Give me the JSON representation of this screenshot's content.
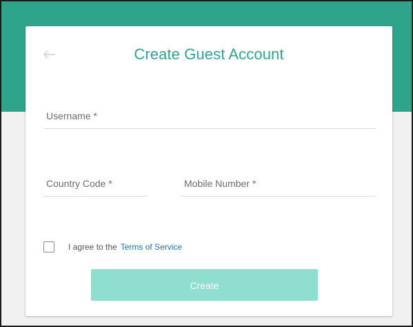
{
  "theme": {
    "accent": "#2ea58b",
    "button_disabled": "#8fded0",
    "link": "#2470b8",
    "page_bg": "#f1f1f1"
  },
  "header": {
    "back_icon": "left-arrow-icon",
    "title": "Create Guest Account"
  },
  "form": {
    "username": {
      "label": "Username *",
      "value": ""
    },
    "country_code": {
      "label": "Country Code *",
      "value": ""
    },
    "mobile_number": {
      "label": "Mobile Number *",
      "value": ""
    },
    "agree": {
      "checked": false,
      "text": "I agree to the",
      "link_text": "Terms of Service"
    },
    "submit_label": "Create",
    "submit_enabled": false
  }
}
